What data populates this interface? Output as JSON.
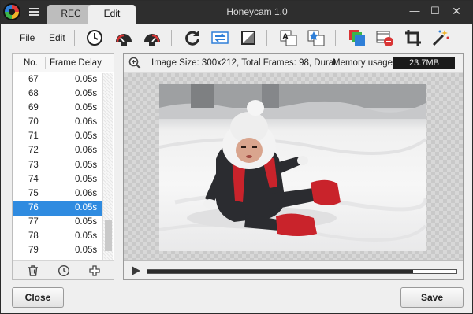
{
  "titlebar": {
    "app_title": "Honeycam 1.0",
    "tabs": [
      {
        "label": "REC"
      },
      {
        "label": "Edit"
      }
    ],
    "minimize_glyph": "—",
    "maximize_glyph": "☐",
    "close_glyph": "✕"
  },
  "toolbar": {
    "file_label": "File",
    "edit_label": "Edit",
    "icons": [
      "clock-icon",
      "speed-down-icon",
      "speed-up-icon",
      "rotate-icon",
      "reverse-icon",
      "filter-icon",
      "text-icon",
      "sticker-icon",
      "image-effect-icon",
      "remove-frames-icon",
      "crop-icon",
      "magic-wand-icon"
    ]
  },
  "frame_list": {
    "headers": {
      "no": "No.",
      "delay": "Frame Delay"
    },
    "rows": [
      {
        "no": "67",
        "delay": "0.05s"
      },
      {
        "no": "68",
        "delay": "0.05s"
      },
      {
        "no": "69",
        "delay": "0.05s"
      },
      {
        "no": "70",
        "delay": "0.06s"
      },
      {
        "no": "71",
        "delay": "0.05s"
      },
      {
        "no": "72",
        "delay": "0.06s"
      },
      {
        "no": "73",
        "delay": "0.05s"
      },
      {
        "no": "74",
        "delay": "0.05s"
      },
      {
        "no": "75",
        "delay": "0.06s"
      },
      {
        "no": "76",
        "delay": "0.05s",
        "selected": true
      },
      {
        "no": "77",
        "delay": "0.05s"
      },
      {
        "no": "78",
        "delay": "0.05s"
      },
      {
        "no": "79",
        "delay": "0.05s"
      }
    ],
    "footer_icons": [
      "trash-icon",
      "clock-icon",
      "add-icon"
    ]
  },
  "preview": {
    "info_text": "Image Size: 300x212, Total Frames: 98, Durat",
    "memory_label": "Memory usage:",
    "memory_value": "23.7MB",
    "playback_progress": 0.86
  },
  "buttons": {
    "close_label": "Close",
    "save_label": "Save"
  },
  "colors": {
    "titlebar_bg": "#2e2e2e",
    "selection": "#2f8be0",
    "accent_red": "#d93434",
    "accent_blue": "#2f7fd8"
  }
}
